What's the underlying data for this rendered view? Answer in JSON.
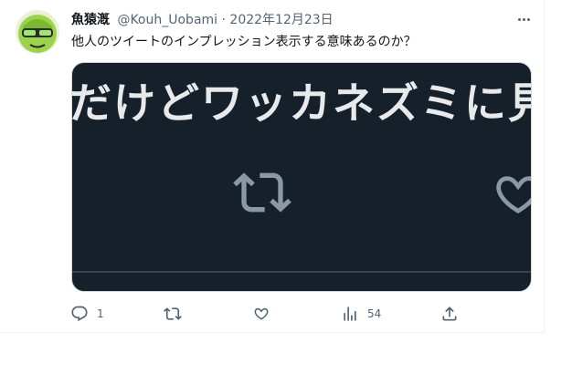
{
  "tweet": {
    "author": {
      "display_name": "魚猿漑",
      "handle": "@Kouh_Uobami",
      "avatar_icon": "green-face-sunglasses-avatar"
    },
    "separator": "·",
    "date": "2022年12月23日",
    "text": "他人のツイートのインプレッション表示する意味あるのか？",
    "media": {
      "text": "だけどワッカネズミに見",
      "icons": [
        "retweet-icon",
        "heart-icon"
      ],
      "background": "#15202b"
    },
    "actions": {
      "reply_count": "1",
      "retweet_count": "",
      "like_count": "",
      "views_count": "54"
    }
  },
  "colors": {
    "text_primary": "#0f1419",
    "text_secondary": "#536471",
    "avatar_green": "#9bd34a",
    "media_bg": "#15202b"
  }
}
